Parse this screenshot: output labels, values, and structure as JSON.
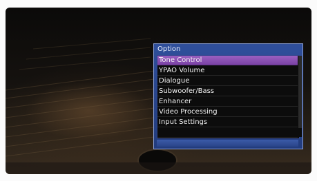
{
  "menu": {
    "title": "Option",
    "selected_index": 0,
    "items": [
      {
        "label": "Tone Control"
      },
      {
        "label": "YPAO Volume"
      },
      {
        "label": "Dialogue"
      },
      {
        "label": "Subwoofer/Bass"
      },
      {
        "label": "Enhancer"
      },
      {
        "label": "Video Processing"
      },
      {
        "label": "Input Settings"
      },
      {
        "label": ""
      }
    ]
  },
  "colors": {
    "panel_blue": "#223c7e",
    "selection_purple": "#7b43a6",
    "list_background": "#0c0c0c",
    "text": "#f3f3f3"
  }
}
